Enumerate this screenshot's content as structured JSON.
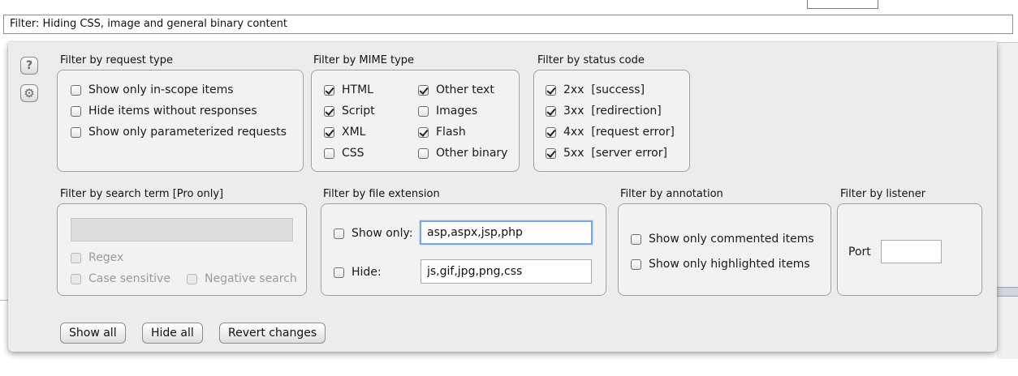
{
  "filter_bar": {
    "text": "Filter: Hiding CSS, image and general binary content"
  },
  "side": {
    "help_glyph": "?",
    "settings_glyph": "⚙"
  },
  "request_type": {
    "label": "Filter by request type",
    "items": [
      {
        "label": "Show only in-scope items",
        "checked": false
      },
      {
        "label": "Hide items without responses",
        "checked": false
      },
      {
        "label": "Show only parameterized requests",
        "checked": false
      }
    ]
  },
  "mime_type": {
    "label": "Filter by MIME type",
    "items": [
      {
        "label": "HTML",
        "checked": true
      },
      {
        "label": "Script",
        "checked": true
      },
      {
        "label": "XML",
        "checked": true
      },
      {
        "label": "CSS",
        "checked": false
      },
      {
        "label": "Other text",
        "checked": true
      },
      {
        "label": "Images",
        "checked": false
      },
      {
        "label": "Flash",
        "checked": true
      },
      {
        "label": "Other binary",
        "checked": false
      }
    ]
  },
  "status_code": {
    "label": "Filter by status code",
    "items": [
      {
        "label": "2xx  [success]",
        "checked": true
      },
      {
        "label": "3xx  [redirection]",
        "checked": true
      },
      {
        "label": "4xx  [request error]",
        "checked": true
      },
      {
        "label": "5xx  [server error]",
        "checked": true
      }
    ]
  },
  "search_term": {
    "label": "Filter by search term [Pro only]",
    "value": "",
    "regex": "Regex",
    "case_sensitive": "Case sensitive",
    "negative_search": "Negative search"
  },
  "file_extension": {
    "label": "Filter by file extension",
    "show_only_label": "Show only:",
    "show_only_value": "asp,aspx,jsp,php",
    "hide_label": "Hide:",
    "hide_value": "js,gif,jpg,png,css"
  },
  "annotation": {
    "label": "Filter by annotation",
    "commented": "Show only commented items",
    "highlighted": "Show only highlighted items"
  },
  "listener": {
    "label": "Filter by listener",
    "port_label": "Port",
    "port_value": ""
  },
  "buttons": {
    "show_all": "Show all",
    "hide_all": "Hide all",
    "revert": "Revert changes"
  }
}
